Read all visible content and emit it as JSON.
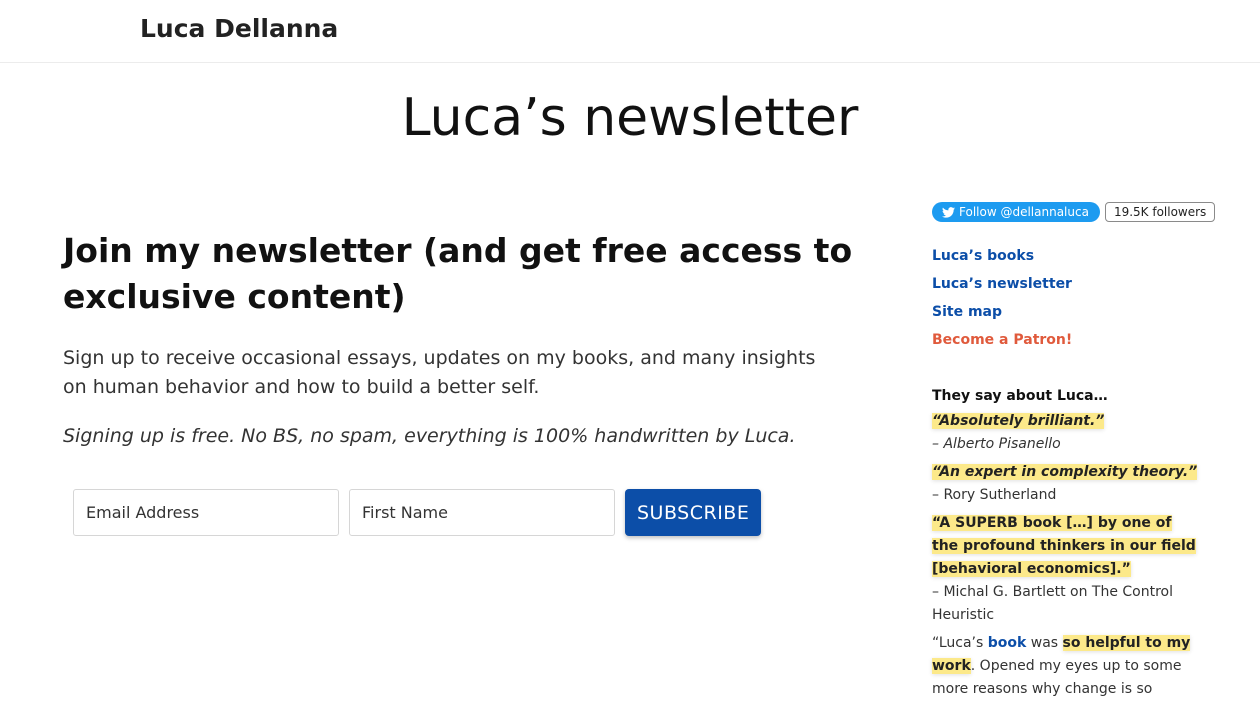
{
  "header": {
    "site_title": "Luca Dellanna"
  },
  "page": {
    "title": "Luca’s newsletter"
  },
  "main": {
    "heading": "Join my newsletter (and get free access to exclusive content)",
    "lead": "Sign up to receive occasional essays, updates on my books, and many insights on human behavior and how to build a better self.",
    "note": "Signing up is free. No BS, no spam, everything is 100% handwritten by Luca.",
    "form": {
      "email_placeholder": "Email Address",
      "name_placeholder": "First Name",
      "submit_label": "SUBSCRIBE"
    }
  },
  "sidebar": {
    "twitter": {
      "follow_label": "Follow @dellannaluca",
      "followers": "19.5K followers"
    },
    "links": [
      {
        "label": "Luca’s books"
      },
      {
        "label": "Luca’s newsletter"
      },
      {
        "label": "Site map"
      },
      {
        "label": "Become a Patron!"
      }
    ],
    "testimonials": {
      "heading": "They say about Luca…",
      "items": [
        {
          "quote": "“Absolutely brilliant.”",
          "author": "– Alberto Pisanello"
        },
        {
          "quote": "“An expert in complexity theory.”",
          "author": "– Rory Sutherland"
        },
        {
          "quote": "“A SUPERB book […] by one of the profound thinkers in our field [behavioral economics].”",
          "author": "– Michal G. Bartlett on The Control Heuristic"
        }
      ],
      "last": {
        "prefix": "“Luca’s ",
        "link": "book",
        "middle": " was ",
        "highlight": "so helpful to my work",
        "suffix": ". Opened my eyes up to some more reasons why change is so"
      }
    }
  },
  "colors": {
    "accent": "#0c4ea8",
    "patron": "#e05a3c",
    "highlight": "#fce98a",
    "twitter": "#1d9bf0"
  }
}
